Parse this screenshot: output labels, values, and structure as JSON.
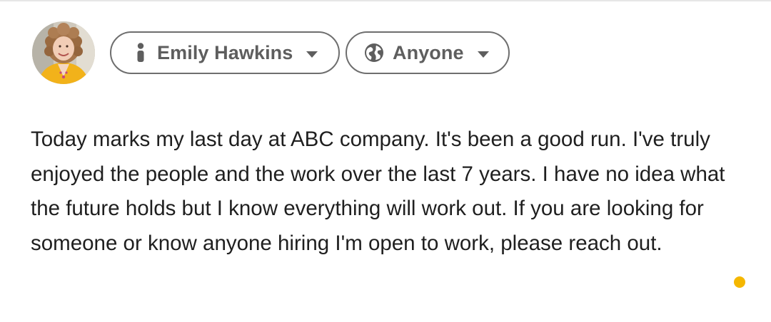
{
  "composer": {
    "author": {
      "name": "Emily Hawkins",
      "icon": "person-icon"
    },
    "audience": {
      "label": "Anyone",
      "icon": "globe-icon"
    },
    "caret_icon": "caret-down-icon",
    "post_text": "Today marks my last day at ABC company. It's been a good run. I've truly enjoyed the people and the work over the last 7 years. I have no idea what the future holds but I know everything will work out. If you are looking for someone or know anyone hiring I'm open to work, please reach out."
  },
  "colors": {
    "pill_border": "#6e6e6e",
    "pill_text": "#5e5e5e",
    "body_text": "#1f1f1f",
    "indicator_dot": "#f5b700"
  }
}
